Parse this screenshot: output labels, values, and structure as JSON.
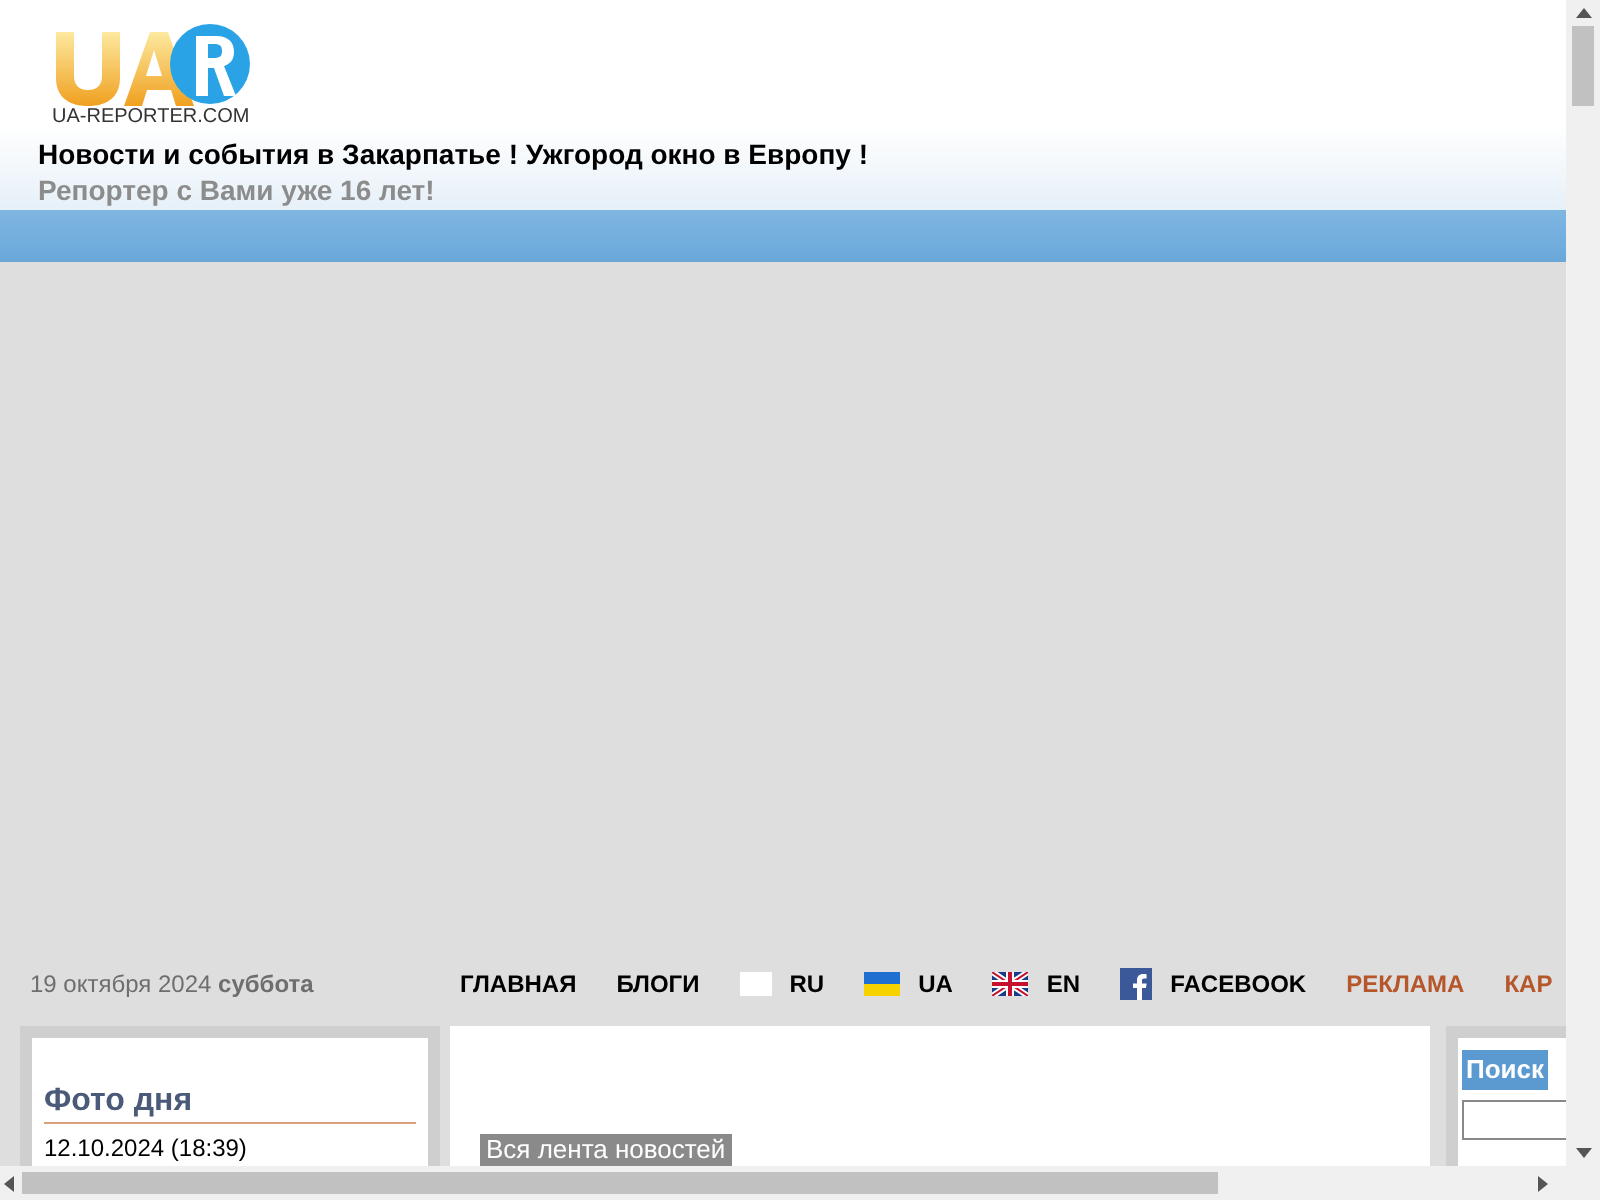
{
  "header": {
    "logo_text": "UA-REPORTER.COM",
    "title": "Новости и события в Закарпатье ! Ужгород окно в Европу !",
    "subtitle": "Репортер с Вами уже 16 лет!"
  },
  "date_bar": {
    "date": "19 октября 2024",
    "weekday": "суббота"
  },
  "nav": [
    {
      "label": "ГЛАВНАЯ",
      "kind": "link"
    },
    {
      "label": "БЛОГИ",
      "kind": "link"
    },
    {
      "label": "RU",
      "kind": "lang"
    },
    {
      "label": "UA",
      "kind": "lang"
    },
    {
      "label": "EN",
      "kind": "lang"
    },
    {
      "label": "FACEBOOK",
      "kind": "social"
    },
    {
      "label": "РЕКЛАМА",
      "kind": "accent"
    },
    {
      "label": "КАР",
      "kind": "accent"
    }
  ],
  "photo_of_day": {
    "heading": "Фото дня",
    "date": "12.10.2024 (18:39)"
  },
  "news": {
    "all_news_link": "Вся лента новостей"
  },
  "search": {
    "heading": "Поиск"
  }
}
